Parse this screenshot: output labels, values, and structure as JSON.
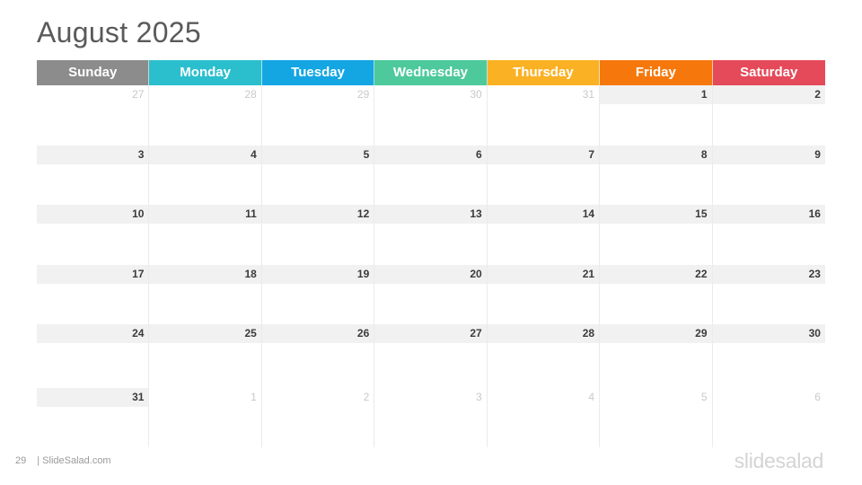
{
  "title": "August 2025",
  "weekdays": [
    {
      "label": "Sunday",
      "color": "#8c8c8c"
    },
    {
      "label": "Monday",
      "color": "#2bbfce"
    },
    {
      "label": "Tuesday",
      "color": "#13a6e3"
    },
    {
      "label": "Wednesday",
      "color": "#4dc99b"
    },
    {
      "label": "Thursday",
      "color": "#fbb124"
    },
    {
      "label": "Friday",
      "color": "#f6780d"
    },
    {
      "label": "Saturday",
      "color": "#e54a5a"
    }
  ],
  "weeks": [
    [
      {
        "n": "27",
        "out": true
      },
      {
        "n": "28",
        "out": true
      },
      {
        "n": "29",
        "out": true
      },
      {
        "n": "30",
        "out": true
      },
      {
        "n": "31",
        "out": true
      },
      {
        "n": "1",
        "out": false
      },
      {
        "n": "2",
        "out": false
      }
    ],
    [
      {
        "n": "3",
        "out": false
      },
      {
        "n": "4",
        "out": false
      },
      {
        "n": "5",
        "out": false
      },
      {
        "n": "6",
        "out": false
      },
      {
        "n": "7",
        "out": false
      },
      {
        "n": "8",
        "out": false
      },
      {
        "n": "9",
        "out": false
      }
    ],
    [
      {
        "n": "10",
        "out": false
      },
      {
        "n": "11",
        "out": false
      },
      {
        "n": "12",
        "out": false
      },
      {
        "n": "13",
        "out": false
      },
      {
        "n": "14",
        "out": false
      },
      {
        "n": "15",
        "out": false
      },
      {
        "n": "16",
        "out": false
      }
    ],
    [
      {
        "n": "17",
        "out": false
      },
      {
        "n": "18",
        "out": false
      },
      {
        "n": "19",
        "out": false
      },
      {
        "n": "20",
        "out": false
      },
      {
        "n": "21",
        "out": false
      },
      {
        "n": "22",
        "out": false
      },
      {
        "n": "23",
        "out": false
      }
    ],
    [
      {
        "n": "24",
        "out": false
      },
      {
        "n": "25",
        "out": false
      },
      {
        "n": "26",
        "out": false
      },
      {
        "n": "27",
        "out": false
      },
      {
        "n": "28",
        "out": false
      },
      {
        "n": "29",
        "out": false
      },
      {
        "n": "30",
        "out": false
      }
    ],
    [
      {
        "n": "31",
        "out": false
      },
      {
        "n": "1",
        "out": true
      },
      {
        "n": "2",
        "out": true
      },
      {
        "n": "3",
        "out": true
      },
      {
        "n": "4",
        "out": true
      },
      {
        "n": "5",
        "out": true
      },
      {
        "n": "6",
        "out": true
      }
    ]
  ],
  "footer": {
    "page_number": "29",
    "site": "| SlideSalad.com",
    "logo": "slidesalad"
  }
}
